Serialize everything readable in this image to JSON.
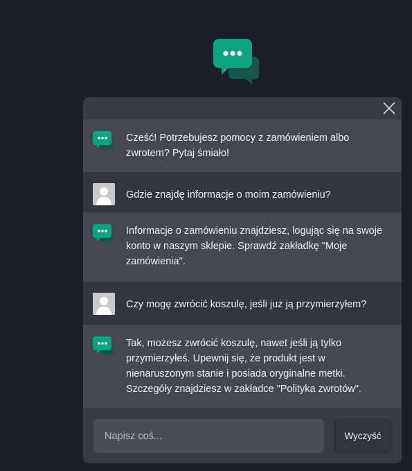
{
  "app": {
    "logo_icon": "chat-bubbles-icon",
    "accent_color": "#10a37f"
  },
  "chat": {
    "close_icon": "close-icon",
    "messages": [
      {
        "role": "bot",
        "avatar_icon": "chat-bubbles-icon",
        "text": "Cześć! Potrzebujesz pomocy z zamówieniem albo zwrotem? Pytaj śmiało!"
      },
      {
        "role": "user",
        "avatar_icon": "user-avatar-icon",
        "text": "Gdzie znajdę informacje o moim zamówieniu?"
      },
      {
        "role": "bot",
        "avatar_icon": "chat-bubbles-icon",
        "text": "Informacje o zamówieniu znajdziesz, logując się na swoje konto w naszym sklepie. Sprawdź zakładkę \"Moje zamówienia\"."
      },
      {
        "role": "user",
        "avatar_icon": "user-avatar-icon",
        "text": "Czy mogę zwrócić koszulę, jeśli już ją przymierzyłem?"
      },
      {
        "role": "bot",
        "avatar_icon": "chat-bubbles-icon",
        "text": "Tak, możesz zwrócić koszulę, nawet jeśli ją tylko przymierzyłeś. Upewnij się, że produkt jest w nienaruszonym stanie i posiada oryginalne metki. Szczegóły znajdziesz w zakładce \"Polityka zwrotów\"."
      }
    ],
    "input": {
      "value": "",
      "placeholder": "Napisz coś..."
    },
    "clear_label": "Wyczyść"
  }
}
